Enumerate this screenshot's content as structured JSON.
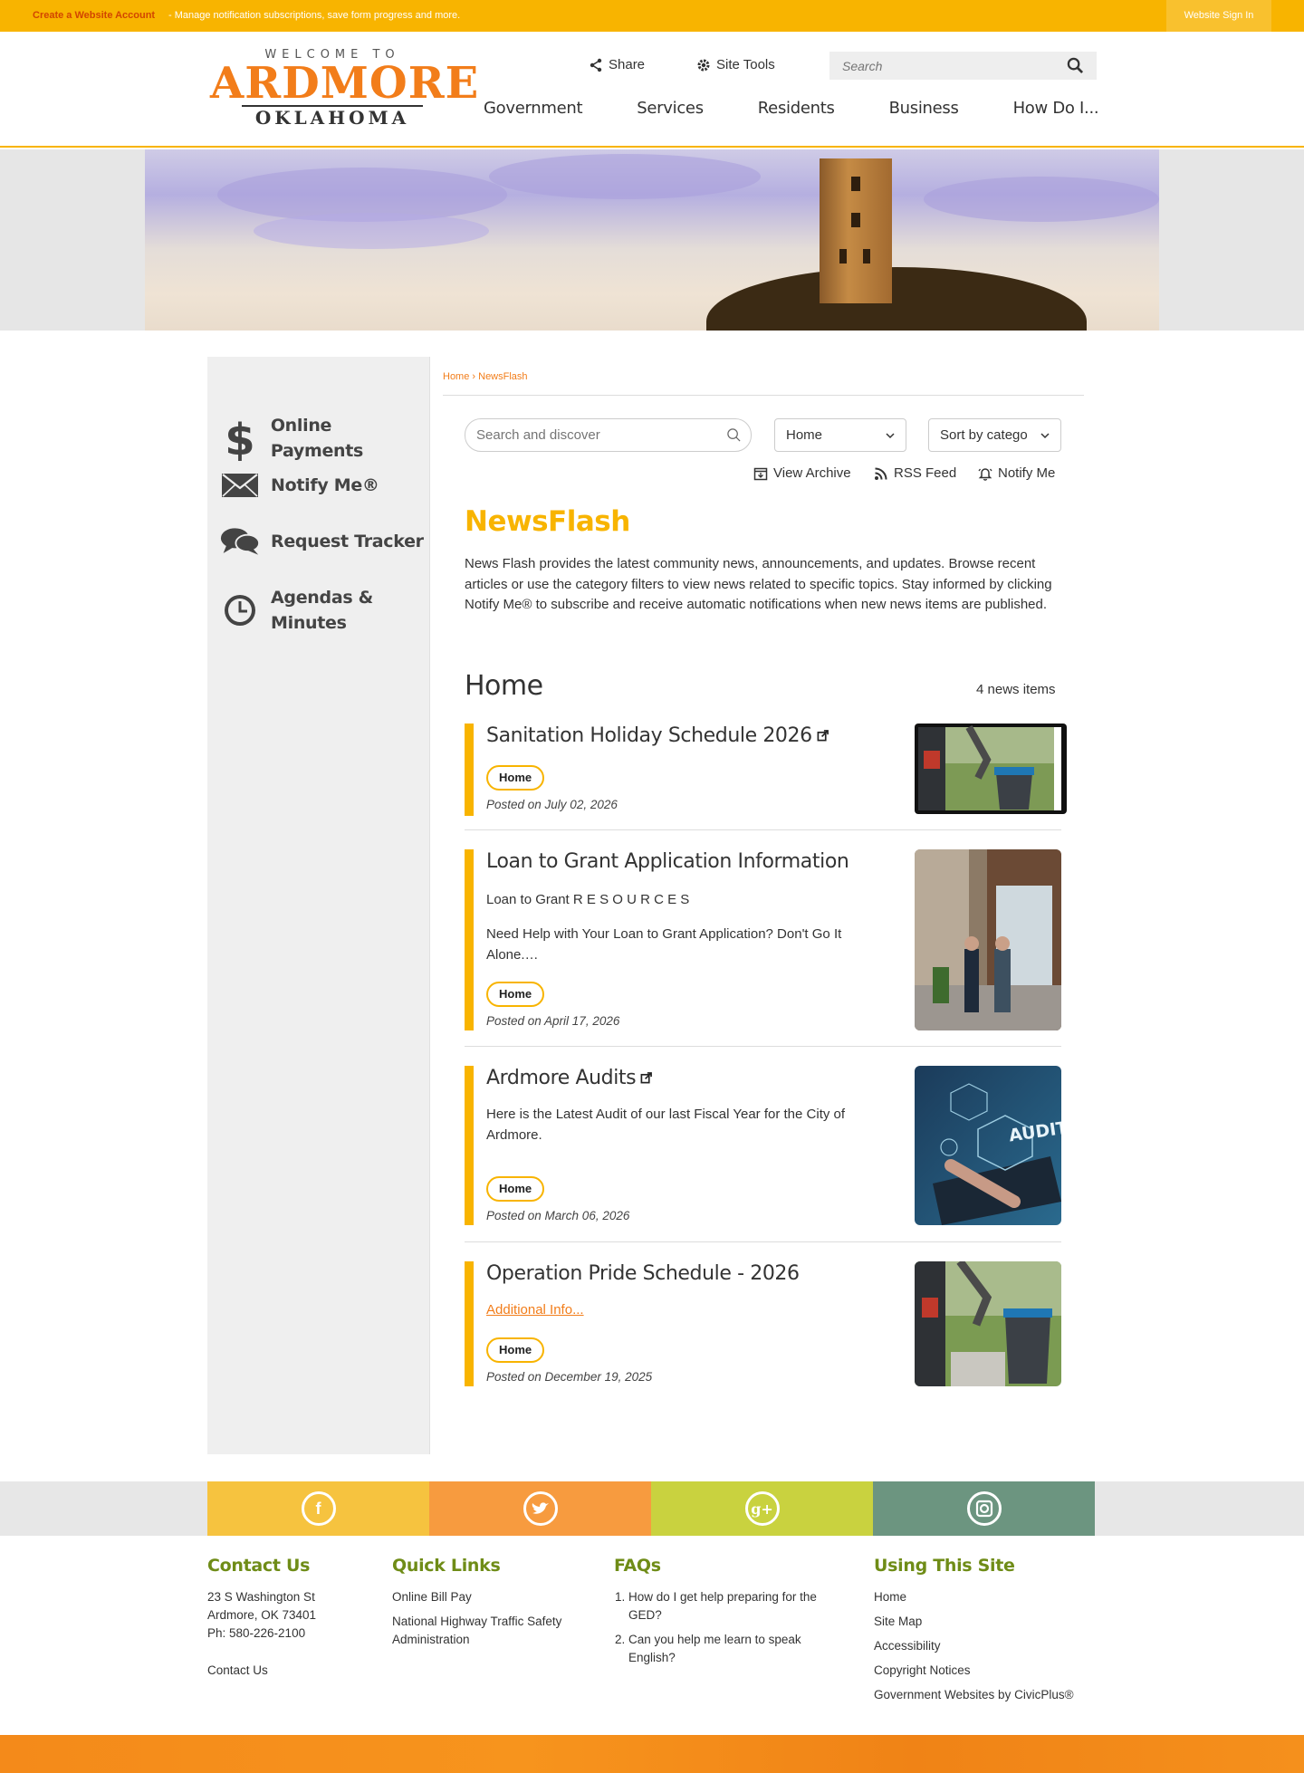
{
  "topbar": {
    "create_account": "Create a Website Account",
    "message": " - Manage notification subscriptions, save form progress and more.",
    "sign_in": "Website Sign In"
  },
  "header": {
    "logo": {
      "welcome": "WELCOME TO",
      "name": "ARDMORE",
      "state": "OKLAHOMA"
    },
    "share_label": "Share",
    "site_tools_label": "Site Tools",
    "search_placeholder": "Search",
    "nav": [
      "Government",
      "Services",
      "Residents",
      "Business",
      "How Do I..."
    ]
  },
  "sidebar": {
    "items": [
      {
        "label": "Online Payments",
        "icon": "dollar-icon"
      },
      {
        "label": "Notify Me®",
        "icon": "envelope-icon"
      },
      {
        "label": "Request Tracker",
        "icon": "chat-bubbles-icon"
      },
      {
        "label": "Agendas & Minutes",
        "icon": "clock-icon"
      }
    ]
  },
  "breadcrumb": {
    "home": "Home",
    "separator": " › ",
    "current": "NewsFlash"
  },
  "filters": {
    "search_placeholder": "Search and discover",
    "category_value": "Home",
    "sort_value": "Sort by category"
  },
  "actions": {
    "archive": "View Archive",
    "rss": "RSS Feed",
    "notify": "Notify Me"
  },
  "newsflash": {
    "title": "NewsFlash",
    "description": "News Flash provides the latest community news, announcements, and updates. Browse recent articles or use the category filters to view news related to specific topics. Stay informed by clicking Notify Me® to subscribe and receive automatic notifications when new news items are published."
  },
  "section": {
    "title": "Home",
    "count": "4 news items"
  },
  "news": [
    {
      "title": "Sanitation Holiday Schedule 2026",
      "external": true,
      "tag": "Home",
      "date": "Posted on July 02, 2026"
    },
    {
      "title": "Loan to Grant Application Information",
      "body1": "Loan to Grant R E S O U R C E S",
      "body2": "Need Help with Your Loan to Grant Application? Don't Go It Alone.…",
      "tag": "Home",
      "date": "Posted on April 17, 2026"
    },
    {
      "title": "Ardmore Audits",
      "external": true,
      "body1": "Here is the Latest Audit of our last Fiscal Year for the City of Ardmore.",
      "tag": "Home",
      "date": "Posted on March 06, 2026",
      "thumb_text": "AUDIT"
    },
    {
      "title": "Operation Pride Schedule - 2026",
      "link": "Additional Info...",
      "tag": "Home",
      "date": "Posted on December 19, 2025"
    }
  ],
  "social": [
    {
      "name": "facebook",
      "glyph": "f",
      "color": "#f6c33f"
    },
    {
      "name": "twitter",
      "glyph": "t",
      "color": "#f79b3f"
    },
    {
      "name": "google-plus",
      "glyph": "g+",
      "color": "#c9d23f"
    },
    {
      "name": "instagram",
      "glyph": "◘",
      "color": "#6c9580"
    }
  ],
  "footer": {
    "contact": {
      "title": "Contact Us",
      "address1": "23 S Washington St",
      "address2": "Ardmore, OK 73401",
      "phone": "Ph: 580-226-2100",
      "link": "Contact Us"
    },
    "quick_links": {
      "title": "Quick Links",
      "items": [
        "Online Bill Pay",
        "National Highway Traffic Safety Administration"
      ]
    },
    "faqs": {
      "title": "FAQs",
      "items": [
        "How do I get help preparing for the GED?",
        "Can you help me learn to speak English?"
      ]
    },
    "using_site": {
      "title": "Using This Site",
      "items": [
        "Home",
        "Site Map",
        "Accessibility",
        "Copyright Notices",
        "Government Websites by CivicPlus®"
      ]
    }
  },
  "colors": {
    "accent": "#f8b400",
    "orange": "#f27d1a",
    "green": "#6f8c17"
  }
}
